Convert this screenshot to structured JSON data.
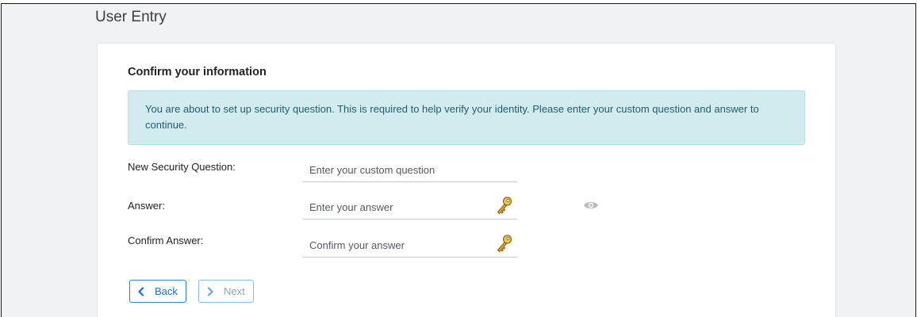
{
  "page": {
    "title": "User Entry"
  },
  "card": {
    "title": "Confirm your information",
    "alert": "You are about to set up security question. This is required to help verify your identity. Please enter your custom question and answer to continue."
  },
  "form": {
    "question": {
      "label": "New Security Question:",
      "placeholder": "Enter your custom question",
      "value": ""
    },
    "answer": {
      "label": "Answer:",
      "placeholder": "Enter your answer",
      "value": ""
    },
    "confirm": {
      "label": "Confirm Answer:",
      "placeholder": "Confirm your answer",
      "value": ""
    }
  },
  "buttons": {
    "back": "Back",
    "next": "Next",
    "next_enabled": false
  },
  "icons": {
    "key": "key-icon",
    "eye": "eye-icon",
    "back": "chevron-left-icon",
    "next": "chevron-right-icon"
  },
  "colors": {
    "accent": "#1f6fc5",
    "alert_bg": "#d2ebee",
    "alert_text": "#1d5f6e",
    "key": "#d7a73a"
  }
}
